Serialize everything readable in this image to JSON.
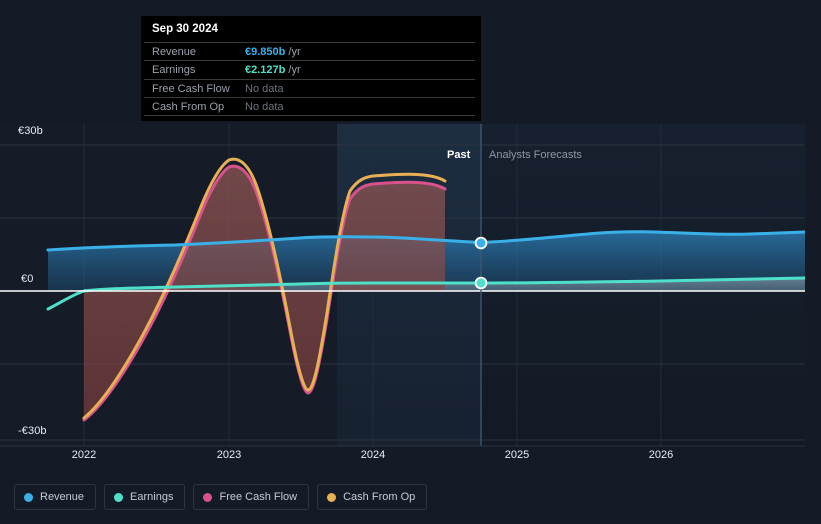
{
  "chart_data": {
    "type": "area",
    "title": "",
    "xlabel": "",
    "ylabel": "",
    "x_ticks": [
      "2022",
      "2023",
      "2024",
      "2025",
      "2026"
    ],
    "y_ticks": [
      "€30b",
      "€0",
      "-€30b"
    ],
    "ylim": [
      -30,
      30
    ],
    "currency": "€",
    "units": "b",
    "grid": true,
    "legend_position": "bottom-left",
    "segments": {
      "past_label": "Past",
      "forecast_label": "Analysts Forecasts",
      "boundary_x_tick": "2024.7"
    },
    "series": [
      {
        "name": "Revenue",
        "color": "#3ab0e8",
        "x": [
          2021.75,
          2022.0,
          2022.35,
          2022.7,
          2023.0,
          2023.35,
          2023.7,
          2024.0,
          2024.35,
          2024.72,
          2025.0,
          2025.4,
          2025.8,
          2026.2,
          2026.6,
          2026.95
        ],
        "values": [
          9.1,
          9.2,
          9.3,
          9.4,
          9.7,
          9.6,
          9.9,
          10.1,
          10.0,
          9.85,
          9.9,
          10.3,
          10.7,
          11.0,
          11.3,
          11.6
        ]
      },
      {
        "name": "Earnings",
        "color": "#4ee0c8",
        "x": [
          2021.75,
          2022.0,
          2022.35,
          2022.7,
          2023.0,
          2023.35,
          2023.7,
          2024.0,
          2024.35,
          2024.72,
          2025.0,
          2025.4,
          2025.8,
          2026.2,
          2026.6,
          2026.95
        ],
        "values": [
          -2.3,
          -1.2,
          -0.9,
          -0.8,
          -0.6,
          -0.3,
          0.1,
          0.4,
          0.3,
          2.127,
          2.2,
          2.4,
          2.6,
          2.8,
          3.0,
          3.2
        ]
      },
      {
        "name": "Free Cash Flow",
        "color": "#d8528c",
        "x": [
          2022.0,
          2022.2,
          2022.5,
          2022.8,
          2023.0,
          2023.15,
          2023.4,
          2023.65,
          2023.8,
          2023.95,
          2024.1,
          2024.35,
          2024.72
        ],
        "values": [
          -30.5,
          -24.0,
          -10.0,
          6.0,
          20.0,
          18.0,
          2.0,
          -16.0,
          -22.0,
          -12.0,
          12.0,
          16.5,
          17.2
        ]
      },
      {
        "name": "Cash From Op",
        "color": "#e8b055",
        "x": [
          2022.0,
          2022.2,
          2022.5,
          2022.8,
          2023.0,
          2023.15,
          2023.4,
          2023.65,
          2023.8,
          2023.95,
          2024.1,
          2024.35,
          2024.72
        ],
        "values": [
          -30.2,
          -23.6,
          -9.6,
          6.5,
          20.6,
          18.6,
          2.5,
          -15.6,
          -21.6,
          -11.4,
          13.0,
          17.6,
          18.4
        ]
      }
    ],
    "hover": {
      "x_tick": "2024.72",
      "points": [
        {
          "series": "Revenue",
          "value": 9.85,
          "color": "#3ab0e8"
        },
        {
          "series": "Earnings",
          "value": 2.127,
          "color": "#4ee0c8"
        }
      ]
    }
  },
  "tooltip": {
    "date": "Sep 30 2024",
    "rows": [
      {
        "label": "Revenue",
        "value": "€9.850b",
        "suffix": " /yr",
        "color": "#3ab0e8",
        "no_data": false
      },
      {
        "label": "Earnings",
        "value": "€2.127b",
        "suffix": " /yr",
        "color": "#4ee0c8",
        "no_data": false
      },
      {
        "label": "Free Cash Flow",
        "value": "No data",
        "suffix": "",
        "color": "#6c7481",
        "no_data": true
      },
      {
        "label": "Cash From Op",
        "value": "No data",
        "suffix": "",
        "color": "#6c7481",
        "no_data": true
      }
    ]
  },
  "legend": {
    "items": [
      {
        "label": "Revenue",
        "color": "#3ab0e8"
      },
      {
        "label": "Earnings",
        "color": "#4ee0c8"
      },
      {
        "label": "Free Cash Flow",
        "color": "#d8528c"
      },
      {
        "label": "Cash From Op",
        "color": "#e8b055"
      }
    ]
  },
  "colors": {
    "background": "#141b27",
    "plot_background": "#151c28",
    "gridline": "#2b3340",
    "zero_line": "#ffffff",
    "forecast_divider": "#3b5772",
    "highlight_band": "#1b3148"
  }
}
